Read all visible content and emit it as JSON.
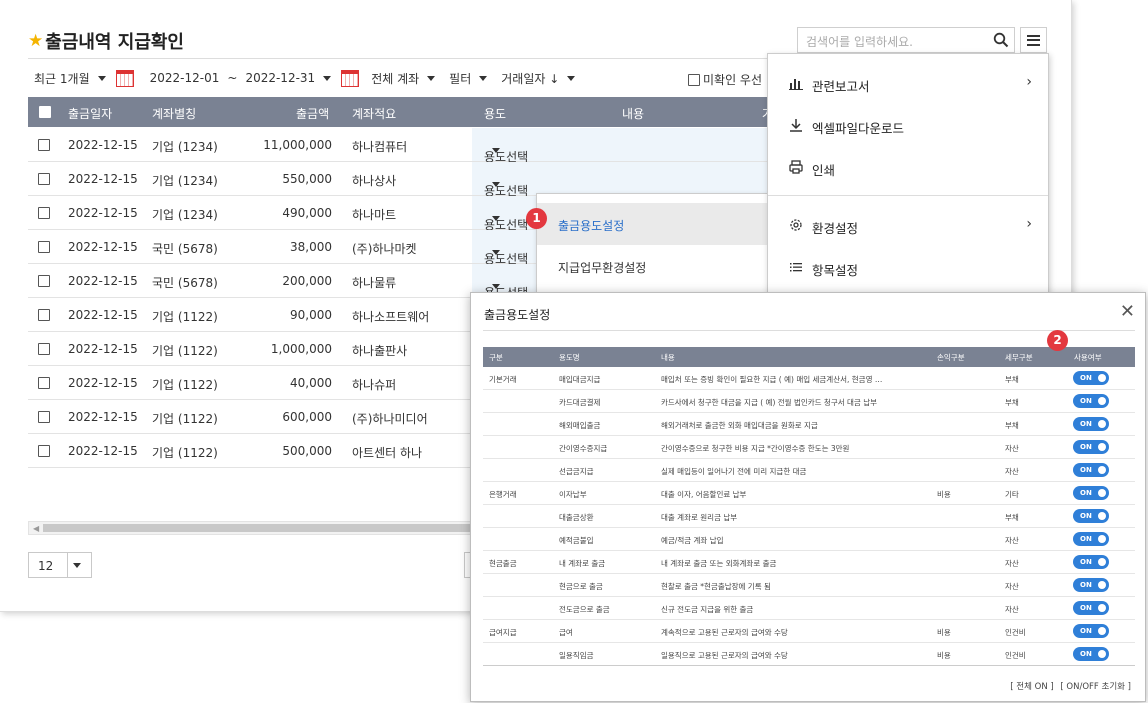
{
  "header": {
    "title": "출금내역 지급확인",
    "search_placeholder": "검색어를 입력하세요."
  },
  "filters": {
    "period": "최근 1개월",
    "date_from": "2022-12-01",
    "date_sep": "~",
    "date_to": "2022-12-31",
    "account": "전체 계좌",
    "filter": "필터",
    "sort": "거래일자 ↓",
    "unconfirmed_first": "미확인 우선"
  },
  "table": {
    "columns": [
      "출금일자",
      "계좌별칭",
      "출금액",
      "계좌적요",
      "용도",
      "내용",
      "거"
    ],
    "rows": [
      {
        "date": "2022-12-15",
        "account": "기업 (1234)",
        "amount": "11,000,000",
        "memo": "하나컴퓨터",
        "usage": "용도선택"
      },
      {
        "date": "2022-12-15",
        "account": "기업 (1234)",
        "amount": "550,000",
        "memo": "하나상사",
        "usage": "용도선택"
      },
      {
        "date": "2022-12-15",
        "account": "기업 (1234)",
        "amount": "490,000",
        "memo": "하나마트",
        "usage": "용도선택"
      },
      {
        "date": "2022-12-15",
        "account": "국민 (5678)",
        "amount": "38,000",
        "memo": "(주)하나마켓",
        "usage": "용도선택"
      },
      {
        "date": "2022-12-15",
        "account": "국민 (5678)",
        "amount": "200,000",
        "memo": "하나물류",
        "usage": "용도선택"
      },
      {
        "date": "2022-12-15",
        "account": "기업 (1122)",
        "amount": "90,000",
        "memo": "하나소프트웨어",
        "usage": ""
      },
      {
        "date": "2022-12-15",
        "account": "기업 (1122)",
        "amount": "1,000,000",
        "memo": "하나출판사",
        "usage": ""
      },
      {
        "date": "2022-12-15",
        "account": "기업 (1122)",
        "amount": "40,000",
        "memo": "하나슈퍼",
        "usage": ""
      },
      {
        "date": "2022-12-15",
        "account": "기업 (1122)",
        "amount": "600,000",
        "memo": "(주)하나미디어",
        "usage": ""
      },
      {
        "date": "2022-12-15",
        "account": "기업 (1122)",
        "amount": "500,000",
        "memo": "아트센터 하나",
        "usage": ""
      }
    ]
  },
  "pagination": {
    "page_size": "12"
  },
  "context_menu": {
    "items": [
      "출금용도설정",
      "지급업무환경설정"
    ],
    "badge": "1"
  },
  "side_menu": {
    "items": [
      "관련보고서",
      "엑셀파일다운로드",
      "인쇄",
      "환경설정",
      "항목설정"
    ]
  },
  "modal": {
    "title": "출금용도설정",
    "badge": "2",
    "columns": [
      "구분",
      "용도명",
      "내용",
      "손익구분",
      "세무구분",
      "사용여부"
    ],
    "rows": [
      {
        "group": "기본거래",
        "name": "매입대금지급",
        "desc": "매입처 또는 증빙 확인이 필요한 지급 ( 예) 매입 세금계산서, 현금영 …",
        "pl": "",
        "tax": "부채",
        "toggle": "ON"
      },
      {
        "group": "",
        "name": "카드대금결제",
        "desc": "카드사에서 청구한 대금을 지급 ( 예) 전월 법인카드 청구서 대금 납부",
        "pl": "",
        "tax": "부채",
        "toggle": "ON"
      },
      {
        "group": "",
        "name": "해외매입출금",
        "desc": "해외거래처로 출금한 외화 매입대금을 원화로 지급",
        "pl": "",
        "tax": "부채",
        "toggle": "ON"
      },
      {
        "group": "",
        "name": "간이영수증지급",
        "desc": "간이영수증으로 청구한 비용 지급 *간이영수증 한도는 3만원",
        "pl": "",
        "tax": "자산",
        "toggle": "ON"
      },
      {
        "group": "",
        "name": "선급금지급",
        "desc": "실제 매입등이 일어나기 전에 미리 지급한 대금",
        "pl": "",
        "tax": "자산",
        "toggle": "ON"
      },
      {
        "group": "은행거래",
        "name": "이자납부",
        "desc": "대출 이자, 어음할인료 납부",
        "pl": "비용",
        "tax": "기타",
        "toggle": "ON"
      },
      {
        "group": "",
        "name": "대출금상환",
        "desc": "대출 계좌로 원리금 납부",
        "pl": "",
        "tax": "부채",
        "toggle": "ON"
      },
      {
        "group": "",
        "name": "예적금불입",
        "desc": "예금/적금 계좌 납입",
        "pl": "",
        "tax": "자산",
        "toggle": "ON"
      },
      {
        "group": "현금출금",
        "name": "내 계좌로 출금",
        "desc": "내 계좌로 출금 또는 외화계좌로 출금",
        "pl": "",
        "tax": "자산",
        "toggle": "ON"
      },
      {
        "group": "",
        "name": "현금으로 출금",
        "desc": "현찰로 출금 *현금출납장에 기록 됨",
        "pl": "",
        "tax": "자산",
        "toggle": "ON"
      },
      {
        "group": "",
        "name": "전도금으로 출금",
        "desc": "신규 전도금 지급을 위한 출금",
        "pl": "",
        "tax": "자산",
        "toggle": "ON"
      },
      {
        "group": "급여지급",
        "name": "급여",
        "desc": "계속적으로 고용된 근로자의 급여와 수당",
        "pl": "비용",
        "tax": "인건비",
        "toggle": "ON"
      },
      {
        "group": "",
        "name": "일용직임금",
        "desc": "일용직으로 고용된 근로자의 급여와 수당",
        "pl": "비용",
        "tax": "인건비",
        "toggle": "ON"
      }
    ],
    "footer": [
      "[ 전체 ON ]",
      "[ ON/OFF 초기화 ]"
    ]
  },
  "colors": {
    "header_bg": "#7a8293",
    "accent_blue": "#2f7fd8",
    "badge_red": "#e3383f",
    "star": "#f4b400"
  },
  "icons": [
    "star-icon",
    "search-icon",
    "hamburger-icon",
    "calendar-icon",
    "report-icon",
    "download-icon",
    "print-icon",
    "gear-icon",
    "list-icon",
    "chevron-right-icon",
    "close-icon"
  ]
}
